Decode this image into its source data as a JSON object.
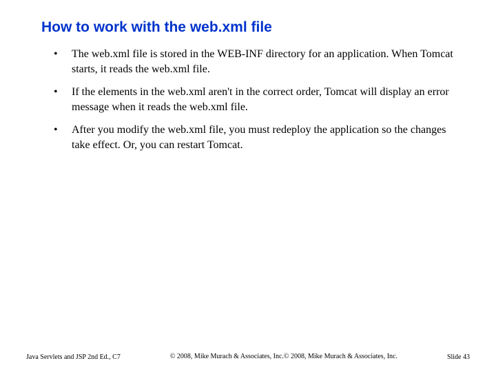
{
  "title": "How to work with the web.xml file",
  "bullets": [
    "The web.xml file is stored in the WEB-INF directory for an application. When Tomcat starts, it reads the web.xml file.",
    "If the elements in the web.xml aren't in the correct order, Tomcat will display an error message when it reads the web.xml file.",
    "After you modify the web.xml file, you must redeploy the application so the changes take effect. Or, you can restart Tomcat."
  ],
  "footer": {
    "left": "Java Servlets and JSP 2nd Ed., C7",
    "center": "© 2008, Mike Murach & Associates, Inc.© 2008, Mike Murach & Associates, Inc.",
    "right": "Slide 43"
  }
}
